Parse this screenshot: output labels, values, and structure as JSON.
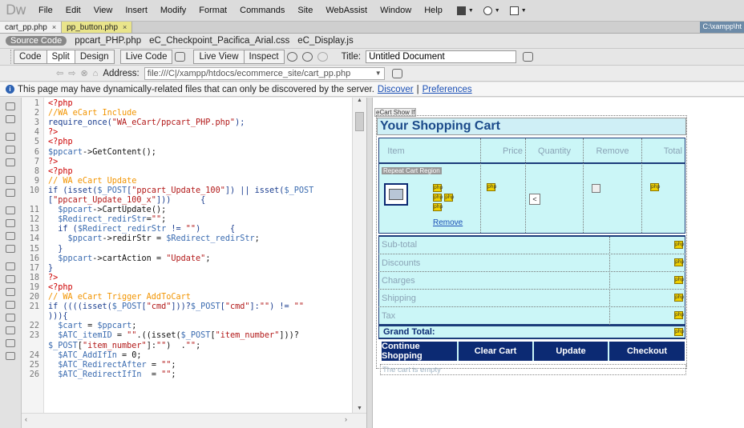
{
  "app": {
    "logo": "Dw"
  },
  "menu": [
    "File",
    "Edit",
    "View",
    "Insert",
    "Modify",
    "Format",
    "Commands",
    "Site",
    "WebAssist",
    "Window",
    "Help"
  ],
  "tabs": [
    {
      "label": "cart_pp.php",
      "close": "×"
    },
    {
      "label": "pp_button.php",
      "close": "×"
    }
  ],
  "tab_path": "C:\\xampp\\ht",
  "related_files": [
    "Source Code",
    "ppcart_PHP.php",
    "eC_Checkpoint_Pacifica_Arial.css",
    "eC_Display.js"
  ],
  "view_buttons": {
    "code": "Code",
    "split": "Split",
    "design": "Design",
    "live_code": "Live Code",
    "live_view": "Live View",
    "inspect": "Inspect"
  },
  "title_label": "Title:",
  "title_value": "Untitled Document",
  "address": {
    "label": "Address:",
    "value": "file:///C|/xampp/htdocs/ecommerce_site/cart_pp.php"
  },
  "info": {
    "text": "This page may have dynamically-related files that can only be discovered by the server.",
    "discover": "Discover",
    "sep": "|",
    "preferences": "Preferences"
  },
  "code_lines": [
    {
      "n": "1",
      "parts": [
        [
          "tag",
          "<?php"
        ]
      ]
    },
    {
      "n": "2",
      "parts": [
        [
          "cm",
          "//WA eCart Include"
        ]
      ]
    },
    {
      "n": "3",
      "parts": [
        [
          "fn",
          "require_once("
        ],
        [
          "str",
          "\"WA_eCart/ppcart_PHP.php\""
        ],
        [
          "fn",
          ");"
        ]
      ]
    },
    {
      "n": "4",
      "parts": [
        [
          "tag",
          "?>"
        ]
      ]
    },
    {
      "n": "5",
      "parts": [
        [
          "tag",
          "<?php"
        ]
      ]
    },
    {
      "n": "6",
      "parts": [
        [
          "var",
          "$ppcart"
        ],
        [
          "pl",
          "->GetContent();"
        ]
      ]
    },
    {
      "n": "7",
      "parts": [
        [
          "tag",
          "?>"
        ]
      ]
    },
    {
      "n": "8",
      "parts": [
        [
          "tag",
          "<?php"
        ]
      ]
    },
    {
      "n": "9",
      "parts": [
        [
          "cm",
          "// WA eCart Update"
        ]
      ]
    },
    {
      "n": "10",
      "parts": [
        [
          "kw",
          "if (isset("
        ],
        [
          "var",
          "$_POST"
        ],
        [
          "kw",
          "["
        ],
        [
          "str",
          "\"ppcart_Update_100\""
        ],
        [
          "kw",
          "]) || isset("
        ],
        [
          "var",
          "$_POST"
        ]
      ]
    },
    {
      "n": "",
      "parts": [
        [
          "kw",
          "["
        ],
        [
          "str",
          "\"ppcart_Update_100_x\""
        ],
        [
          "kw",
          "]))      {"
        ]
      ]
    },
    {
      "n": "11",
      "parts": [
        [
          "pl",
          "  "
        ],
        [
          "var",
          "$ppcart"
        ],
        [
          "pl",
          "->CartUpdate();"
        ]
      ]
    },
    {
      "n": "12",
      "parts": [
        [
          "pl",
          "  "
        ],
        [
          "var",
          "$Redirect_redirStr"
        ],
        [
          "pl",
          "="
        ],
        [
          "str",
          "\"\""
        ],
        [
          "pl",
          ";"
        ]
      ]
    },
    {
      "n": "13",
      "parts": [
        [
          "pl",
          "  "
        ],
        [
          "kw",
          "if ("
        ],
        [
          "var",
          "$Redirect_redirStr"
        ],
        [
          "kw",
          " != "
        ],
        [
          "str",
          "\"\""
        ],
        [
          "kw",
          ")      {"
        ]
      ]
    },
    {
      "n": "14",
      "parts": [
        [
          "pl",
          "    "
        ],
        [
          "var",
          "$ppcart"
        ],
        [
          "pl",
          "->redirStr = "
        ],
        [
          "var",
          "$Redirect_redirStr"
        ],
        [
          "pl",
          ";"
        ]
      ]
    },
    {
      "n": "15",
      "parts": [
        [
          "kw",
          "  }"
        ]
      ]
    },
    {
      "n": "16",
      "parts": [
        [
          "pl",
          "  "
        ],
        [
          "var",
          "$ppcart"
        ],
        [
          "pl",
          "->cartAction = "
        ],
        [
          "str",
          "\"Update\""
        ],
        [
          "pl",
          ";"
        ]
      ]
    },
    {
      "n": "17",
      "parts": [
        [
          "kw",
          "}"
        ]
      ]
    },
    {
      "n": "18",
      "parts": [
        [
          "tag",
          "?>"
        ]
      ]
    },
    {
      "n": "19",
      "parts": [
        [
          "tag",
          "<?php"
        ]
      ]
    },
    {
      "n": "20",
      "parts": [
        [
          "cm",
          "// WA eCart Trigger AddToCart"
        ]
      ]
    },
    {
      "n": "21",
      "parts": [
        [
          "kw",
          "if ((((isset("
        ],
        [
          "var",
          "$_POST"
        ],
        [
          "kw",
          "["
        ],
        [
          "str",
          "\"cmd\""
        ],
        [
          "kw",
          "]))?"
        ],
        [
          "var",
          "$_POST"
        ],
        [
          "kw",
          "["
        ],
        [
          "str",
          "\"cmd\""
        ],
        [
          "kw",
          "]:"
        ],
        [
          "str",
          "\"\""
        ],
        [
          "kw",
          ") != "
        ],
        [
          "str",
          "\"\""
        ]
      ]
    },
    {
      "n": "",
      "parts": [
        [
          "kw",
          "))){"
        ]
      ]
    },
    {
      "n": "22",
      "parts": [
        [
          "pl",
          "  "
        ],
        [
          "var",
          "$cart"
        ],
        [
          "pl",
          " = "
        ],
        [
          "var",
          "$ppcart"
        ],
        [
          "pl",
          ";"
        ]
      ]
    },
    {
      "n": "23",
      "parts": [
        [
          "pl",
          "  "
        ],
        [
          "var",
          "$ATC_itemID"
        ],
        [
          "pl",
          " = "
        ],
        [
          "str",
          "\"\""
        ],
        [
          "pl",
          ".((isset("
        ],
        [
          "var",
          "$_POST"
        ],
        [
          "pl",
          "["
        ],
        [
          "str",
          "\"item_number\""
        ],
        [
          "pl",
          "]))?"
        ]
      ]
    },
    {
      "n": "",
      "parts": [
        [
          "var",
          "$_POST"
        ],
        [
          "pl",
          "["
        ],
        [
          "str",
          "\"item_number\""
        ],
        [
          "pl",
          "]:"
        ],
        [
          "str",
          "\"\""
        ],
        [
          "pl",
          ")  ."
        ],
        [
          "str",
          "\"\""
        ],
        [
          "pl",
          ";"
        ]
      ]
    },
    {
      "n": "24",
      "parts": [
        [
          "pl",
          "  "
        ],
        [
          "var",
          "$ATC_AddIfIn"
        ],
        [
          "pl",
          " = 0;"
        ]
      ]
    },
    {
      "n": "25",
      "parts": [
        [
          "pl",
          "  "
        ],
        [
          "var",
          "$ATC_RedirectAfter"
        ],
        [
          "pl",
          " = "
        ],
        [
          "str",
          "\"\""
        ],
        [
          "pl",
          ";"
        ]
      ]
    },
    {
      "n": "26",
      "parts": [
        [
          "pl",
          "  "
        ],
        [
          "var",
          "$ATC_RedirectIfIn"
        ],
        [
          "pl",
          "  = "
        ],
        [
          "str",
          "\"\""
        ],
        [
          "pl",
          ";"
        ]
      ]
    }
  ],
  "design": {
    "ecart_label": "eCart Show If",
    "title": "Your Shopping Cart",
    "columns": [
      "Item",
      "Price",
      "Quantity",
      "Remove",
      "Total"
    ],
    "repeat_label": "Repeat Cart Region",
    "php_icon": "php",
    "qty_value": "<",
    "remove_link": "Remove",
    "summary": [
      "Sub-total",
      "Discounts",
      "Charges",
      "Shipping",
      "Tax"
    ],
    "grand_total": "Grand Total:",
    "buttons": [
      "Continue Shopping",
      "Clear Cart",
      "Update",
      "Checkout"
    ],
    "empty_msg": "The cart is empty"
  }
}
